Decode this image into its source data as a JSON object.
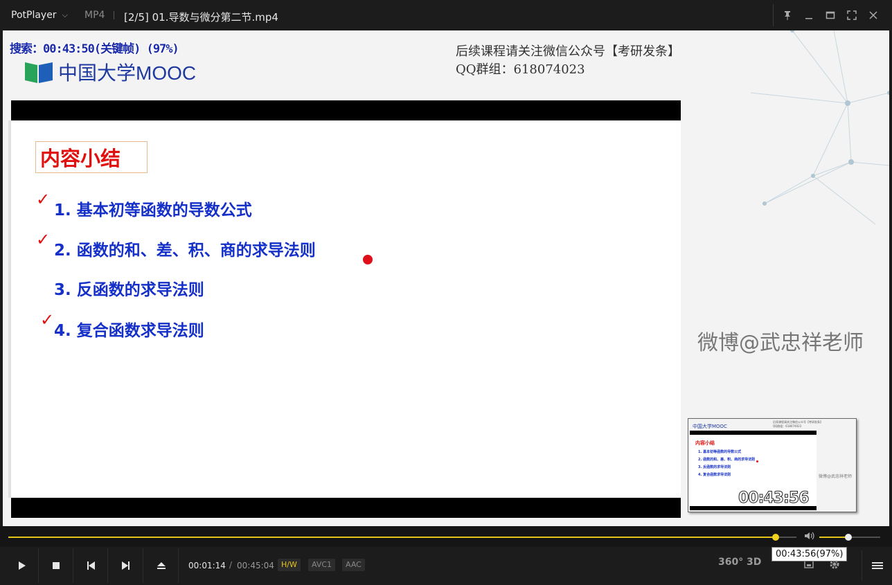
{
  "titlebar": {
    "app_name": "PotPlayer",
    "chevron": "⌵",
    "format": "MP4",
    "title": "[2/5] 01.导数与微分第二节.mp4",
    "controls": [
      "pin-icon",
      "minimize-icon",
      "maximize-icon",
      "fullscreen-icon",
      "close-icon"
    ]
  },
  "video": {
    "seek_osd": "搜索：00:43:50(关键帧) (97%)",
    "mooc_logo": "中国大学MOOC",
    "notice_line1": "后续课程请关注微信公众号【考研发条】",
    "notice_line2": "QQ群组：618074023",
    "slide": {
      "title": "内容小结",
      "items": [
        {
          "text": "1. 基本初等函数的导数公式",
          "checked": true
        },
        {
          "text": "2. 函数的和、差、积、商的求导法则",
          "checked": true
        },
        {
          "text": "3. 反函数的求导法则",
          "checked": false
        },
        {
          "text": "4. 复合函数求导法则",
          "checked": true
        }
      ],
      "check_mark": "✓"
    },
    "watermark": "微博@武忠祥老师"
  },
  "thumbnail": {
    "logo": "中国大学MOOC",
    "notice_line1": "后续课程请关注微信公众号【考研发条】",
    "notice_line2": "QQ群组：618074023",
    "title": "内容小结",
    "items": [
      "1. 基本初等函数的导数公式",
      "2. 函数的和、差、积、商的求导法则",
      "3. 反函数的求导法则",
      "4. 复合函数求导法则"
    ],
    "watermark": "微博@武忠祥老师",
    "time": "00:43:56"
  },
  "progress": {
    "played_fraction": 0.9735,
    "volume_fraction": 0.48,
    "tooltip": "00:43:56(97%)"
  },
  "controls": {
    "current_time": "00:01:14",
    "separator": "/",
    "total_time": "00:45:04",
    "tags": [
      "H/W",
      "AVC1",
      "AAC"
    ],
    "right": [
      "360°",
      "3D"
    ]
  },
  "colors": {
    "accent": "#e6c51a",
    "slide_blue": "#1530c8",
    "slide_red": "#e0100e"
  }
}
